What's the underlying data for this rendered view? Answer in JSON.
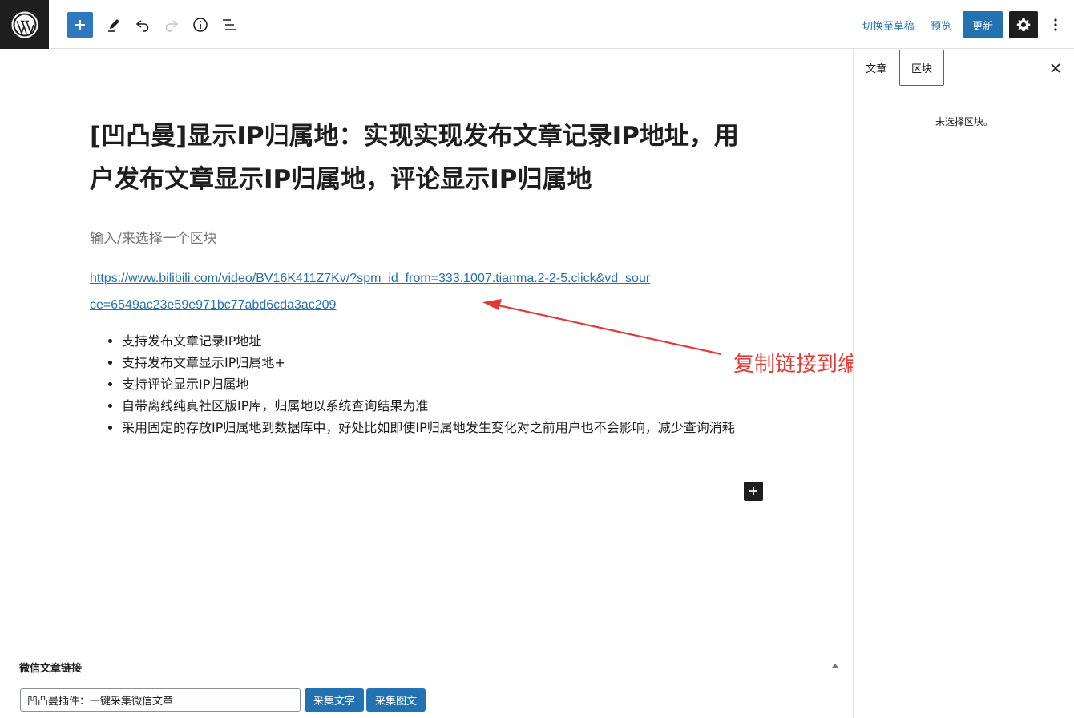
{
  "toolbar": {
    "switch_to_draft": "切换至草稿",
    "preview": "预览",
    "update": "更新"
  },
  "sidebar": {
    "tabs": [
      {
        "label": "文章"
      },
      {
        "label": "区块"
      }
    ],
    "empty_message": "未选择区块。"
  },
  "editor": {
    "title": "[凹凸曼]显示IP归属地：实现实现发布文章记录IP地址，用户发布文章显示IP归属地，评论显示IP归属地",
    "placeholder": "输入/来选择一个区块",
    "link_text": "https://www.bilibili.com/video/BV16K411Z7Kv/?spm_id_from=333.1007.tianma.2-2-5.click&vd_source=6549ac23e59e971bc77abd6cda3ac209",
    "features": [
      "支持发布文章记录IP地址",
      "支持发布文章显示IP归属地+",
      "支持评论显示IP归属地",
      "自带离线纯真社区版IP库，归属地以系统查询结果为准",
      "采用固定的存放IP归属地到数据库中，好处比如即使IP归属地发生变化对之前用户也不会影响，减少查询消耗"
    ]
  },
  "annotation": {
    "text": "复制链接到编辑器里",
    "color": "#e53935"
  },
  "metabox": {
    "title": "微信文章链接",
    "input_value": "凹凸曼插件：一键采集微信文章",
    "collect_text_button": "采集文字",
    "collect_image_text_button": "采集图文"
  },
  "colors": {
    "accent": "#2271b1",
    "dark": "#1e1e1e"
  }
}
